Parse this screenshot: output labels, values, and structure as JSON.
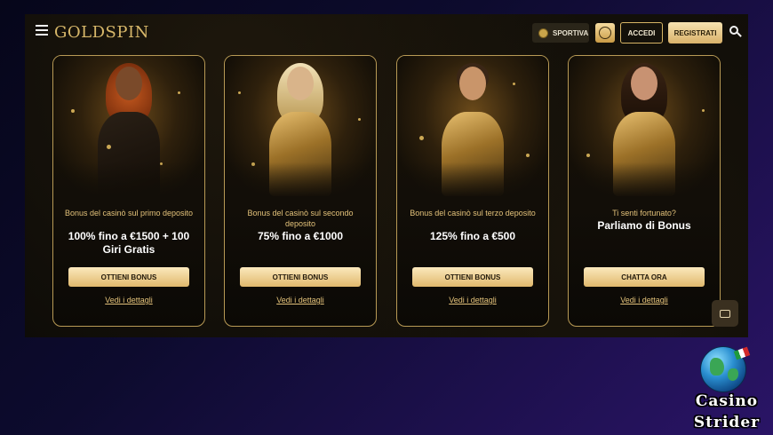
{
  "header": {
    "logo": "GOLDSPIN",
    "sportiva_label": "SPORTIVA",
    "accedi_label": "ACCEDI",
    "registrati_label": "REGISTRATI"
  },
  "cards": [
    {
      "subtitle": "Bonus del casinò sul primo deposito",
      "headline": "100% fino a €1500 + 100 Giri Gratis",
      "cta": "OTTIENI BONUS",
      "details": "Vedi i dettagli"
    },
    {
      "subtitle": "Bonus del casinò sul secondo deposito",
      "headline": "75% fino a €1000",
      "cta": "OTTIENI BONUS",
      "details": "Vedi i dettagli"
    },
    {
      "subtitle": "Bonus del casinò sul terzo deposito",
      "headline": "125% fino a €500",
      "cta": "OTTIENI BONUS",
      "details": "Vedi i dettagli"
    },
    {
      "subtitle": "Ti senti fortunato?",
      "headline": "Parliamo di Bonus",
      "cta": "CHATTA ORA",
      "details": "Vedi i dettagli"
    }
  ],
  "watermark": {
    "line1": "Casino",
    "line2": "Strider"
  },
  "colors": {
    "accent_gold": "#d7b565",
    "card_border": "#b89a55",
    "background": "#0e0c08"
  }
}
